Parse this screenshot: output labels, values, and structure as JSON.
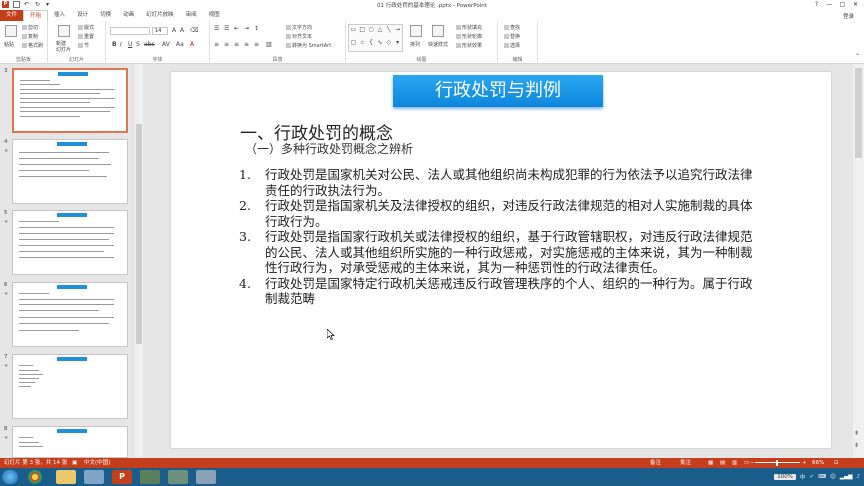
{
  "window": {
    "title": "01 行政处罚的基本理论 .pptx - PowerPoint",
    "controls": [
      "?",
      "—",
      "□",
      "✕"
    ],
    "login": "登录"
  },
  "tabs": [
    "文件",
    "开始",
    "插入",
    "设计",
    "切换",
    "动画",
    "幻灯片放映",
    "审阅",
    "视图"
  ],
  "active_tab": "开始",
  "ribbon": {
    "clipboard": {
      "label": "剪贴板",
      "paste": "粘贴",
      "cut": "剪切",
      "copy": "复制",
      "format": "格式刷"
    },
    "slides": {
      "label": "幻灯片",
      "new_slide": "新建\n幻灯片",
      "layout": "版式",
      "reset": "重置",
      "section": "节"
    },
    "font": {
      "label": "字体",
      "size": "14"
    },
    "paragraph": {
      "label": "段落",
      "text_dir": "文字方向",
      "align_text": "对齐文本",
      "smartart": "转换为 SmartArt"
    },
    "drawing": {
      "label": "绘图",
      "arrange": "排列",
      "quick_styles": "快速样式",
      "fill": "形状填充",
      "outline": "形状轮廓",
      "effects": "形状效果"
    },
    "editing": {
      "label": "编辑",
      "find": "查找",
      "replace": "替换",
      "select": "选择"
    }
  },
  "thumbnails": [
    {
      "num": "3",
      "selected": true
    },
    {
      "num": "4",
      "selected": false
    },
    {
      "num": "5",
      "selected": false
    },
    {
      "num": "6",
      "selected": false
    },
    {
      "num": "7",
      "selected": false
    },
    {
      "num": "8",
      "selected": false
    }
  ],
  "slide": {
    "banner": "行政处罚与判例",
    "heading": "一、行政处罚的概念",
    "subheading": "（一）多种行政处罚概念之辨析",
    "items": [
      {
        "num": "1.",
        "text": "行政处罚是国家机关对公民、法人或其他组织尚未构成犯罪的行为依法予以追究行政法律责任的行政执法行为。"
      },
      {
        "num": "2.",
        "text": "行政处罚是指国家机关及法律授权的组织，对违反行政法律规范的相对人实施制裁的具体行政行为。"
      },
      {
        "num": "3.",
        "text": "行政处罚是指国家行政机关或法律授权的组织，基于行政管辖职权，对违反行政法律规范的公民、法人或其他组织所实施的一种行政惩戒，对实施惩戒的主体来说，其为一种制裁性行政行为，对承受惩戒的主体来说，其为一种惩罚性的行政法律责任。"
      },
      {
        "num": "4.",
        "text": "行政处罚是国家特定行政机关惩戒违反行政管理秩序的个人、组织的一种行为。属于行政制裁范畴"
      }
    ]
  },
  "status": {
    "slide_info": "幻灯片 第 3 张，共 14 张",
    "language": "中文(中国)",
    "notes": "备注",
    "comments": "批注",
    "zoom": "66%"
  },
  "taskbar": {
    "zoom_badge": "100%",
    "tray_icons": [
      "中",
      "✓",
      "⌨",
      "☺"
    ]
  }
}
